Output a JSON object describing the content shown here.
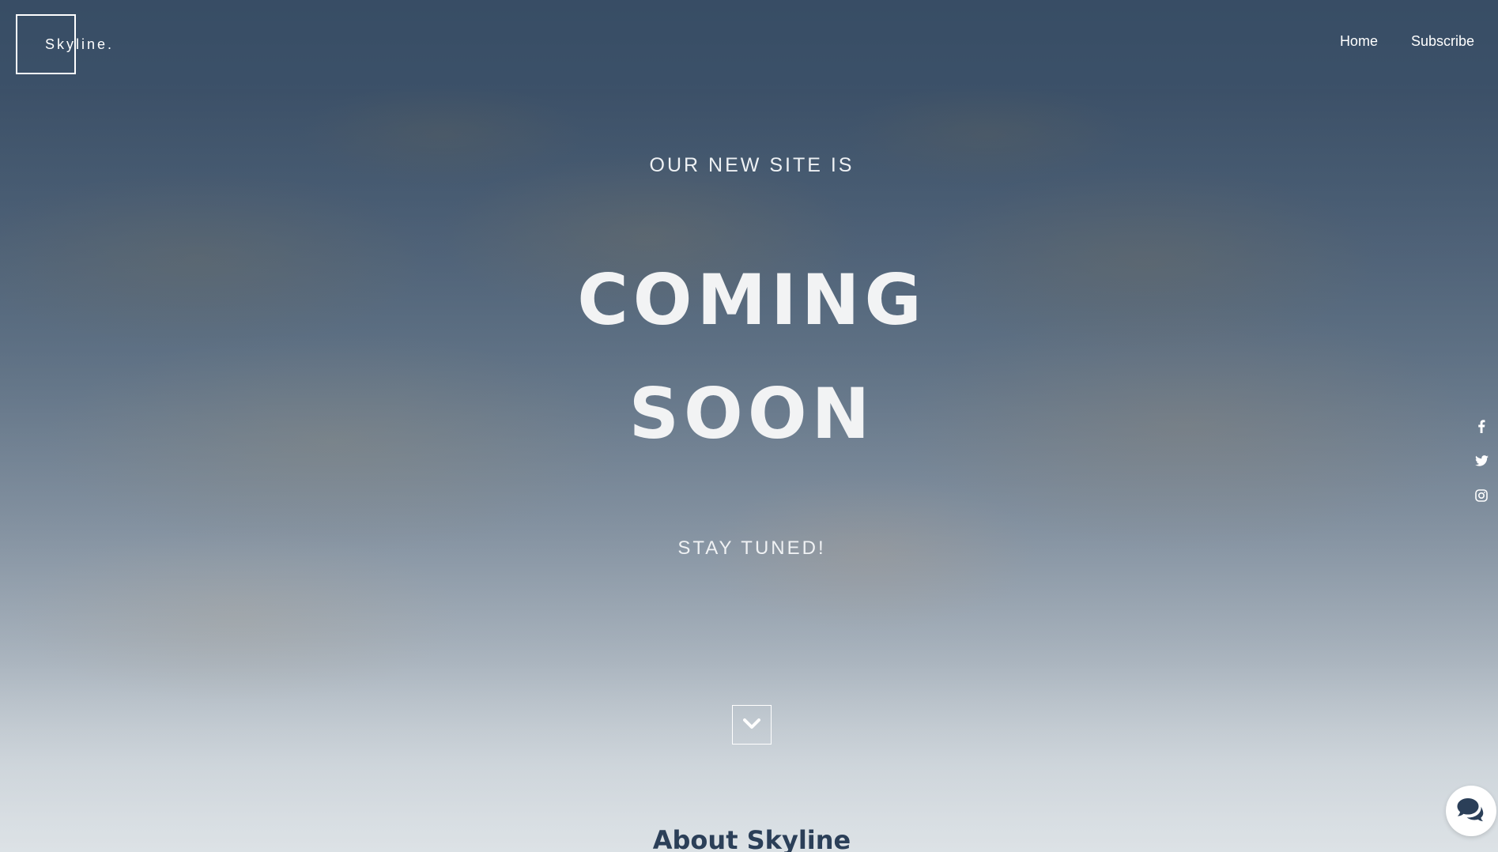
{
  "brand": {
    "name": "Skyline."
  },
  "nav": {
    "items": [
      {
        "label": "Home"
      },
      {
        "label": "Subscribe"
      }
    ]
  },
  "hero": {
    "pretitle": "OUR NEW SITE IS",
    "title_line1": "COMING",
    "title_line2": "SOON",
    "tagline": "STAY TUNED!"
  },
  "social": {
    "icons": [
      "facebook-icon",
      "twitter-icon",
      "instagram-icon"
    ]
  },
  "about": {
    "title": "About Skyline"
  },
  "colors": {
    "accent_dark": "#2b3f58",
    "text_light": "#ffffff"
  }
}
